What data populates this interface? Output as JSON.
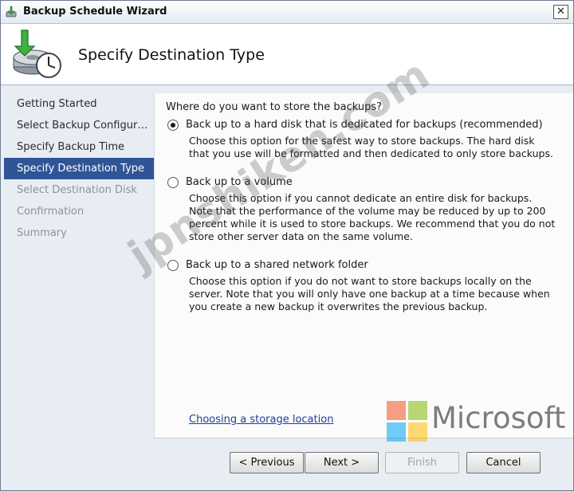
{
  "window": {
    "title": "Backup Schedule Wizard",
    "close_glyph": "✕"
  },
  "header": {
    "title": "Specify Destination Type"
  },
  "nav": {
    "items": [
      {
        "label": "Getting Started",
        "state": "normal"
      },
      {
        "label": "Select Backup Configur…",
        "state": "normal"
      },
      {
        "label": "Specify Backup Time",
        "state": "normal"
      },
      {
        "label": "Specify Destination Type",
        "state": "selected"
      },
      {
        "label": "Select Destination Disk",
        "state": "disabled"
      },
      {
        "label": "Confirmation",
        "state": "disabled"
      },
      {
        "label": "Summary",
        "state": "disabled"
      }
    ]
  },
  "main": {
    "question": "Where do you want to store the backups?",
    "options": [
      {
        "label": "Back up to a hard disk that is dedicated for backups (recommended)",
        "checked": true,
        "desc": "Choose this option for the safest way to store backups. The hard disk that you use will be formatted and then dedicated to only store backups."
      },
      {
        "label": "Back up to a volume",
        "checked": false,
        "desc": "Choose this option if you cannot dedicate an entire disk for backups. Note that the performance of the volume may be reduced by up to 200 percent while it is used to store backups. We recommend that you do not store other server data on the same volume."
      },
      {
        "label": "Back up to a shared network folder",
        "checked": false,
        "desc": "Choose this option if you do not want to store backups locally on the server. Note that you will only have one backup at a time because when you create a new backup it overwrites the previous backup."
      }
    ],
    "link": "Choosing a storage location"
  },
  "buttons": {
    "previous": "< Previous",
    "next": "Next >",
    "finish": "Finish",
    "cancel": "Cancel"
  },
  "overlay": {
    "watermark": "jpnshiken.com",
    "brand": "Microsoft",
    "brand_colors": [
      "#f25022",
      "#7fba00",
      "#00a4ef",
      "#ffb900"
    ]
  }
}
